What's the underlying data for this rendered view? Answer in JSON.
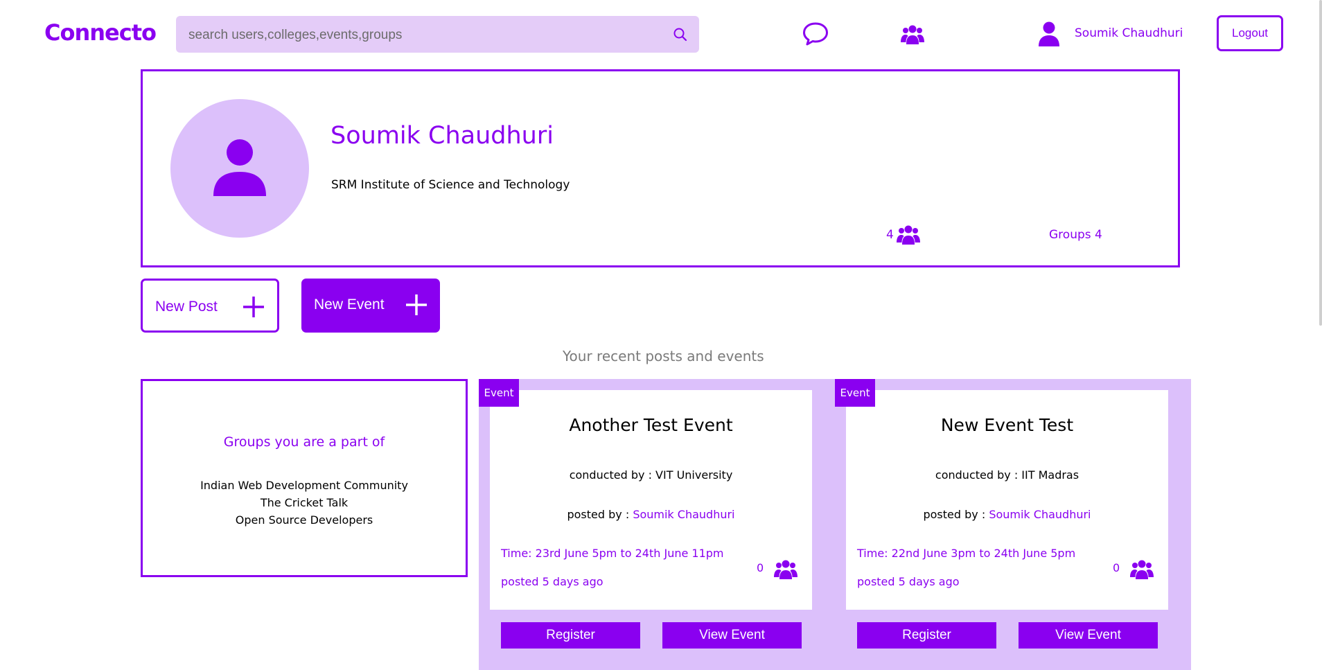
{
  "brand": {
    "logo": "Connecto"
  },
  "search": {
    "placeholder": "search users,colleges,events,groups",
    "value": ""
  },
  "nav": {
    "user_name": "Soumik Chaudhuri",
    "logout_label": "Logout"
  },
  "profile": {
    "name": "Soumik Chaudhuri",
    "college": "SRM Institute of Science and Technology",
    "friends_count": "4",
    "groups_label": "Groups 4"
  },
  "actions": {
    "new_post": "New Post",
    "new_event": "New Event"
  },
  "recent_title": "Your recent posts and events",
  "groups_box": {
    "title": "Groups you are a part of",
    "items": [
      "Indian Web Development Community",
      "The Cricket Talk",
      "Open Source Developers"
    ]
  },
  "events": [
    {
      "tag": "Event",
      "title": "Another Test Event",
      "conducted": "conducted by : VIT University",
      "posted_prefix": "posted by : ",
      "posted_by": "Soumik Chaudhuri",
      "time": "Time: 23rd June 5pm to 24th June 11pm",
      "ago": "posted 5 days ago",
      "count": "0",
      "register_label": "Register",
      "view_label": "View Event"
    },
    {
      "tag": "Event",
      "title": "New Event Test",
      "conducted": "conducted by : IIT Madras",
      "posted_prefix": "posted by : ",
      "posted_by": "Soumik Chaudhuri",
      "time": "Time: 22nd June 3pm to 24th June 5pm",
      "ago": "posted 5 days ago",
      "count": "0",
      "register_label": "Register",
      "view_label": "View Event"
    }
  ],
  "colors": {
    "accent": "#8a00f0",
    "accent_light": "#dcc0fb",
    "search_bg": "#e4ccf8"
  },
  "icons": [
    "search-icon",
    "chat-icon",
    "groups-icon",
    "user-icon",
    "plus-icon"
  ]
}
